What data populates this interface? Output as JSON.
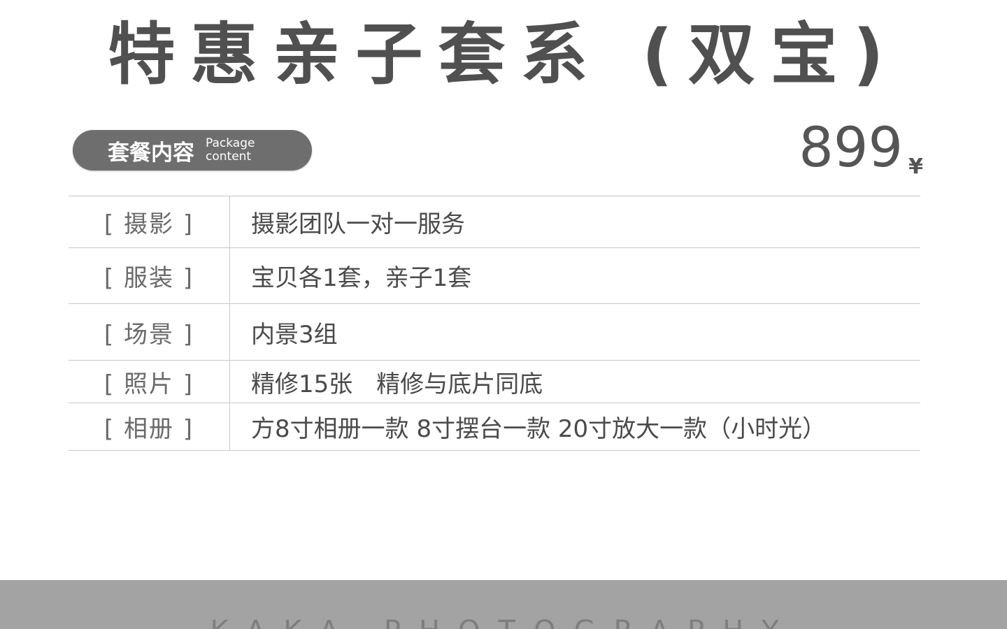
{
  "title": "特惠亲子套系 (双宝)",
  "package_pill": {
    "cn": "套餐内容",
    "en_line1": "Package",
    "en_line2": "content"
  },
  "price": {
    "amount": "899",
    "unit": "¥"
  },
  "table": {
    "rows": [
      {
        "label": "[ 摄影 ]",
        "value": "摄影团队一对一服务"
      },
      {
        "label": "[ 服装 ]",
        "value": "宝贝各1套，亲子1套"
      },
      {
        "label": "[ 场景 ]",
        "value": "内景3组"
      },
      {
        "label": "[ 照片 ]",
        "value": "精修15张　精修与底片同底"
      },
      {
        "label": "[ 相册 ]",
        "value": "方8寸相册一款  8寸摆台一款  20寸放大一款（小时光）"
      }
    ]
  },
  "footer": {
    "brand": "KAKA PHOTOGRAPHY"
  }
}
